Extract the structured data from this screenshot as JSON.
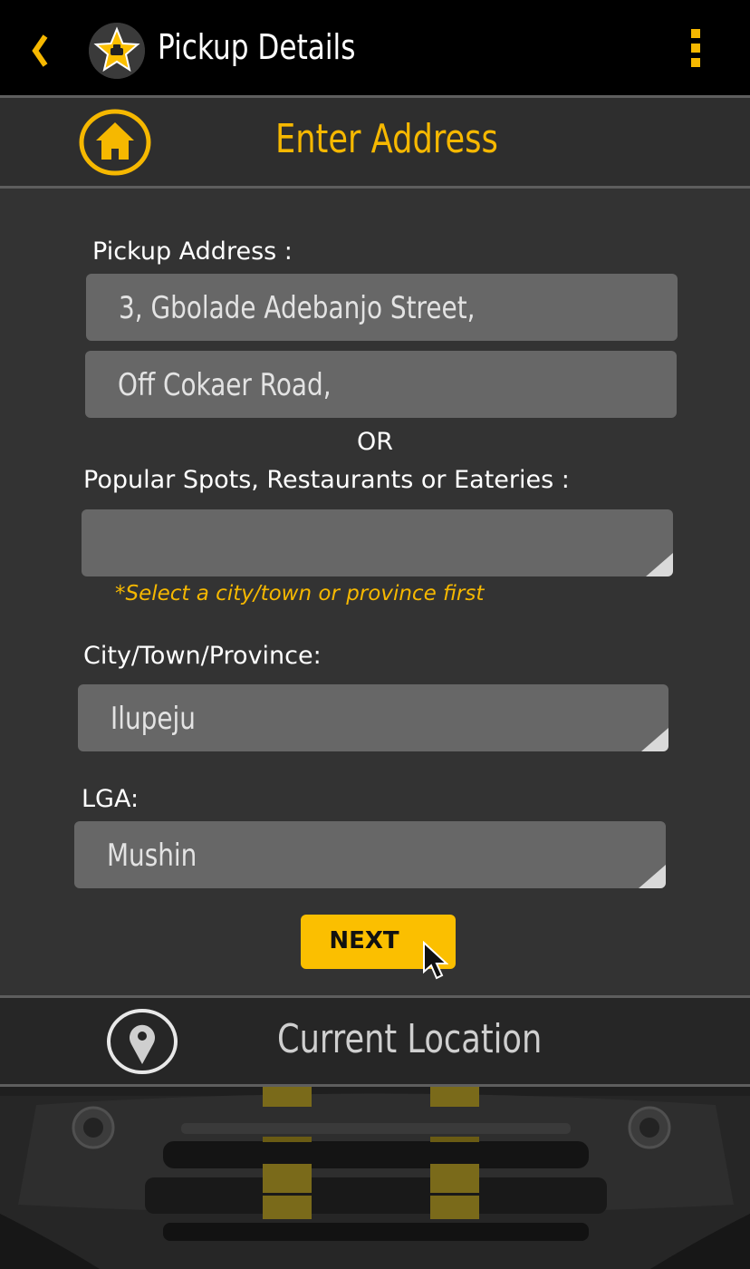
{
  "app_bar": {
    "title": "Pickup Details",
    "back_icon": "chevron-left-icon",
    "logo_icon": "star-taxi-logo-icon",
    "menu_icon": "kebab-menu-icon"
  },
  "sub_header": {
    "title": "Enter Address",
    "home_icon": "home-icon"
  },
  "form": {
    "pickup_label": "Pickup Address :",
    "pickup_line1": "3, Gbolade Adebanjo Street,",
    "pickup_line2": "Off Cokaer Road,",
    "or_text": "OR",
    "spots_label": "Popular Spots, Restaurants or Eateries :",
    "spots_value": "",
    "spots_hint": "*Select a city/town or province first",
    "city_label": "City/Town/Province:",
    "city_value": "Ilupeju",
    "lga_label": "LGA:",
    "lga_value": "Mushin",
    "next_label": "NEXT"
  },
  "location_bar": {
    "title": "Current Location",
    "icon": "map-pin-icon"
  },
  "colors": {
    "accent": "#f6b800",
    "background": "#333333",
    "field": "#676767",
    "appbar": "#000000"
  }
}
